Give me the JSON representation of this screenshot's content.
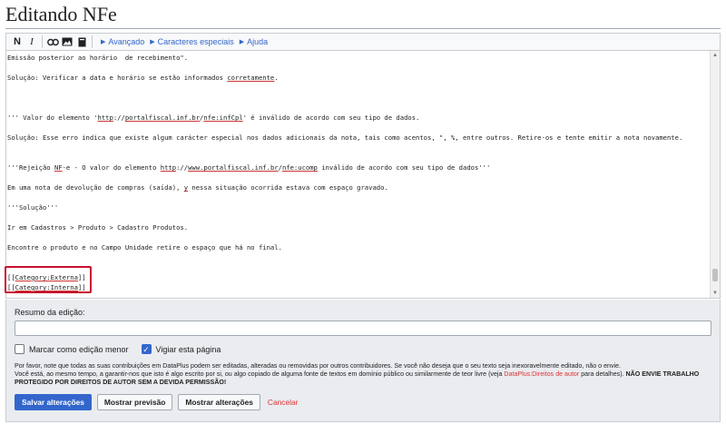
{
  "page": {
    "title": "Editando NFe"
  },
  "toolbar": {
    "bold_label": "N",
    "italic_label": "I",
    "icons": [
      "link-icon",
      "image-icon",
      "template-icon"
    ],
    "advanced_label": "Avançado",
    "special_chars_label": "Caracteres especiais",
    "help_label": "Ajuda"
  },
  "editor": {
    "lines": [
      {
        "segments": [
          {
            "text": "Emissão posterior ao horário  de recebimento\"."
          }
        ]
      },
      {
        "segments": [
          {
            "text": ""
          }
        ]
      },
      {
        "segments": [
          {
            "text": "Solução: Verificar a data e horário se estão informados "
          },
          {
            "text": "corretamente",
            "underline": true
          },
          {
            "text": "."
          }
        ]
      },
      {
        "segments": [
          {
            "text": ""
          }
        ]
      },
      {
        "segments": [
          {
            "text": ""
          }
        ]
      },
      {
        "segments": [
          {
            "text": ""
          }
        ]
      },
      {
        "segments": [
          {
            "text": "''' Valor do elemento '"
          },
          {
            "text": "http",
            "underline": true
          },
          {
            "text": "://"
          },
          {
            "text": "portalfiscal.inf.br",
            "underline": true
          },
          {
            "text": "/"
          },
          {
            "text": "nfe:infCpl",
            "underline": true
          },
          {
            "text": "' é inválido de acordo com seu tipo de dados."
          }
        ]
      },
      {
        "segments": [
          {
            "text": ""
          }
        ]
      },
      {
        "segments": [
          {
            "text": "Solução: Esse erro indica que existe algum carácter especial nos dados adicionais da nota, tais como acentos, \", %, entre outros. Retire-os e tente emitir a nota novamente."
          }
        ]
      },
      {
        "segments": [
          {
            "text": ""
          }
        ]
      },
      {
        "segments": [
          {
            "text": ""
          }
        ]
      },
      {
        "segments": [
          {
            "text": "'''Rejeição "
          },
          {
            "text": "NF",
            "underline": true
          },
          {
            "text": "-e - O valor do elemento "
          },
          {
            "text": "http",
            "underline": true
          },
          {
            "text": "://"
          },
          {
            "text": "www.portalfiscal.inf.br",
            "underline": true
          },
          {
            "text": "/"
          },
          {
            "text": "nfe:ucomp",
            "underline": true
          },
          {
            "text": " inválido de acordo com seu tipo de dados'''"
          }
        ]
      },
      {
        "segments": [
          {
            "text": ""
          }
        ]
      },
      {
        "segments": [
          {
            "text": "Em uma nota de devolução de compras (saída), "
          },
          {
            "text": "y",
            "underline": true
          },
          {
            "text": " nessa situação ocorrida estava com espaço gravado."
          }
        ]
      },
      {
        "segments": [
          {
            "text": ""
          }
        ]
      },
      {
        "segments": [
          {
            "text": "'''Solução'''"
          }
        ]
      },
      {
        "segments": [
          {
            "text": ""
          }
        ]
      },
      {
        "segments": [
          {
            "text": "Ir em Cadastros > Produto > Cadastro Produtos."
          }
        ]
      },
      {
        "segments": [
          {
            "text": ""
          }
        ]
      },
      {
        "segments": [
          {
            "text": "Encontre o produto e no Campo Unidade retire o espaço que há no final."
          }
        ]
      },
      {
        "segments": [
          {
            "text": ""
          }
        ]
      },
      {
        "segments": [
          {
            "text": ""
          }
        ]
      },
      {
        "segments": [
          {
            "text": "[["
          },
          {
            "text": "Category:Externa",
            "underline": true
          },
          {
            "text": "]]"
          }
        ]
      },
      {
        "segments": [
          {
            "text": "[["
          },
          {
            "text": "Category:Interna",
            "underline": true
          },
          {
            "text": "]]"
          }
        ]
      }
    ]
  },
  "options": {
    "summary_label": "Resumo da edição:",
    "summary_value": "",
    "minor_edit_label": "Marcar como edição menor",
    "minor_edit_checked": false,
    "watch_label": "Vigiar esta página",
    "watch_checked": true,
    "notice_line1": "Por favor, note que todas as suas contribuições em DataPlus podem ser editadas, alteradas ou removidas por outros contribuidores. Se você não deseja que o seu texto seja inexoravelmente editado, não o envie.",
    "notice_line2_before": "Você está, ao mesmo tempo, a garantir-nos que isto é algo escrito por si, ou algo copiado de alguma fonte de textos em domínio público ou similarmente de teor livre (veja ",
    "notice_link": "DataPlus:Direitos de autor",
    "notice_line2_after": " para detalhes). ",
    "notice_bold": "NÃO ENVIE TRABALHO PROTEGIDO POR DIREITOS DE AUTOR SEM A DEVIDA PERMISSÃO!"
  },
  "buttons": {
    "save": "Salvar alterações",
    "preview": "Mostrar previsão",
    "changes": "Mostrar alterações",
    "cancel": "Cancelar"
  }
}
